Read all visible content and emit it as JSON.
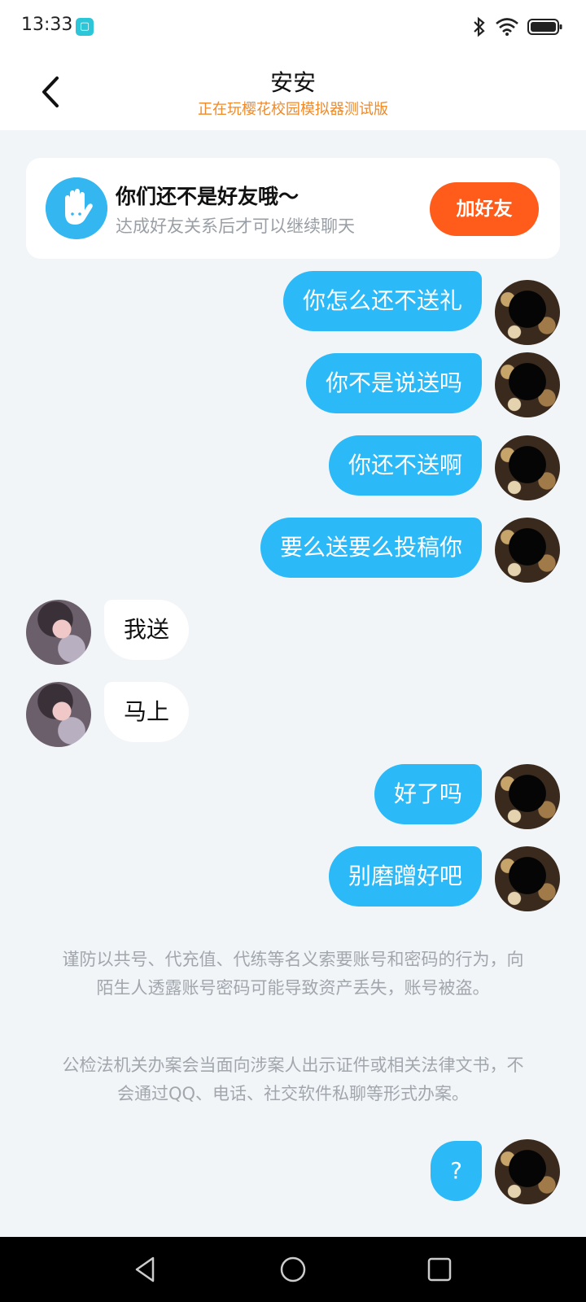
{
  "status_bar": {
    "time": "13:33",
    "icons": [
      "app-notification-icon",
      "bluetooth-icon",
      "wifi-icon",
      "battery-icon"
    ]
  },
  "header": {
    "title": "安安",
    "subtitle": "正在玩樱花校园模拟器测试版"
  },
  "friend_card": {
    "title": "你们还不是好友哦～",
    "subtitle": "达成好友关系后才可以继续聊天",
    "button": "加好友"
  },
  "messages": [
    {
      "side": "mine",
      "text": "你怎么还不送礼"
    },
    {
      "side": "mine",
      "text": "你不是说送吗"
    },
    {
      "side": "mine",
      "text": "你还不送啊"
    },
    {
      "side": "mine",
      "text": "要么送要么投稿你"
    },
    {
      "side": "theirs",
      "text": "我送"
    },
    {
      "side": "theirs",
      "text": "马上"
    },
    {
      "side": "mine",
      "text": "好了吗"
    },
    {
      "side": "mine",
      "text": "别磨蹭好吧"
    },
    {
      "side": "mine",
      "text": "?"
    }
  ],
  "notices": [
    "谨防以共号、代充值、代练等名义索要账号和密码的行为，向陌生人透露账号密码可能导致资产丢失，账号被盗。",
    "公检法机关办案会当面向涉案人出示证件或相关法律文书，不会通过QQ、电话、社交软件私聊等形式办案。"
  ],
  "colors": {
    "my_bubble": "#2bb9f7",
    "their_bubble": "#ffffff",
    "add_friend_button": "#ff5b1a",
    "subtitle": "#ee8a2a",
    "background": "#f2f5f8"
  }
}
